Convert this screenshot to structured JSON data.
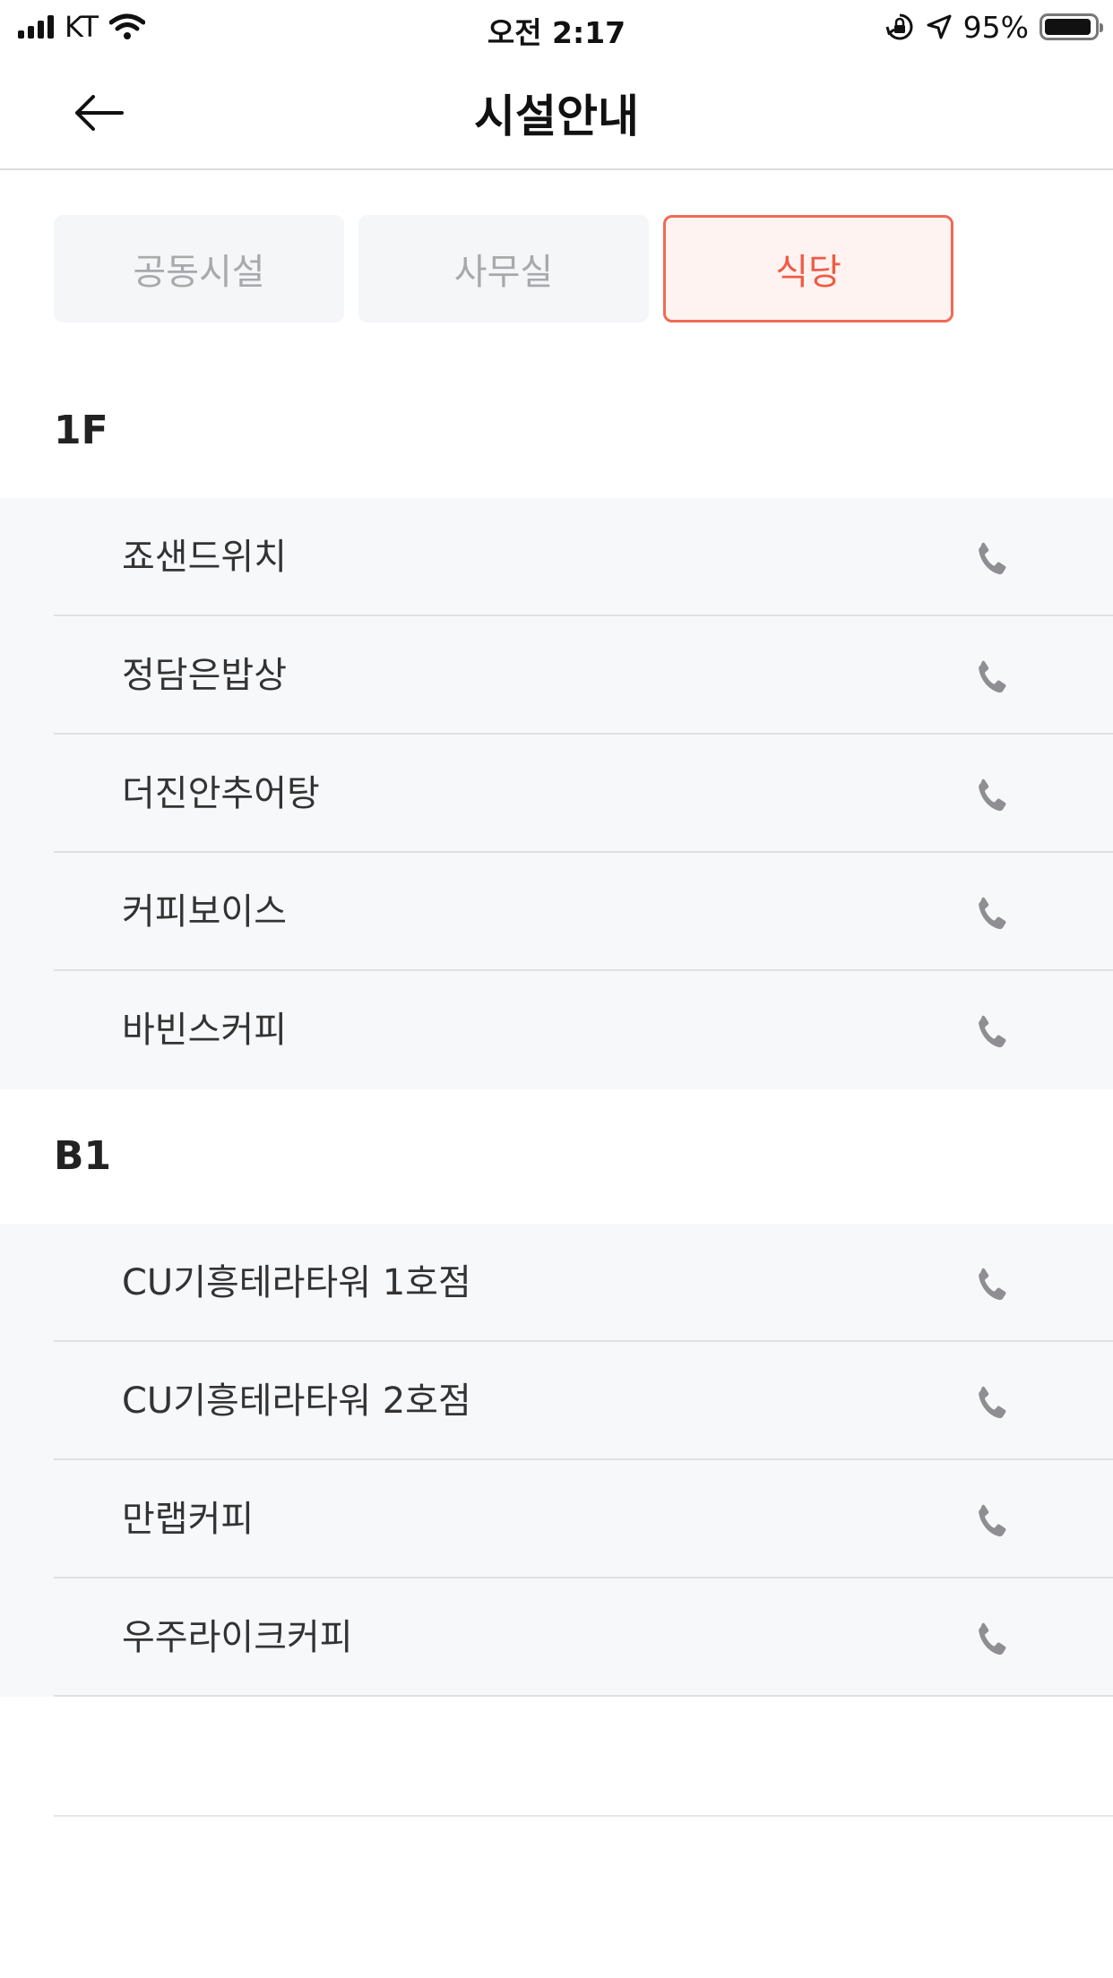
{
  "status_bar": {
    "carrier": "KT",
    "time": "오전 2:17",
    "battery": "95%",
    "battery_level": 0.95,
    "icons": [
      "signal-icon",
      "wifi-icon",
      "orientation-lock-icon",
      "location-arrow-icon",
      "battery-icon"
    ]
  },
  "nav": {
    "title": "시설안내",
    "back_icon": "back-arrow-icon"
  },
  "tabs": [
    {
      "label": "공동시설",
      "active": false
    },
    {
      "label": "사무실",
      "active": false
    },
    {
      "label": "식당",
      "active": true
    }
  ],
  "sections": [
    {
      "floor": "1F",
      "items": [
        "죠샌드위치",
        "정담은밥상",
        "더진안추어탕",
        "커피보이스",
        "바빈스커피"
      ]
    },
    {
      "floor": "B1",
      "items": [
        "CU기흥테라타워 1호점",
        "CU기흥테라타워 2호점",
        "만랩커피",
        "우주라이크커피"
      ]
    }
  ],
  "colors": {
    "accent": "#ef5b44",
    "accent_bg": "#fff3f1",
    "list_bg": "#f7f8fa",
    "phone_icon": "#8e8e93"
  }
}
